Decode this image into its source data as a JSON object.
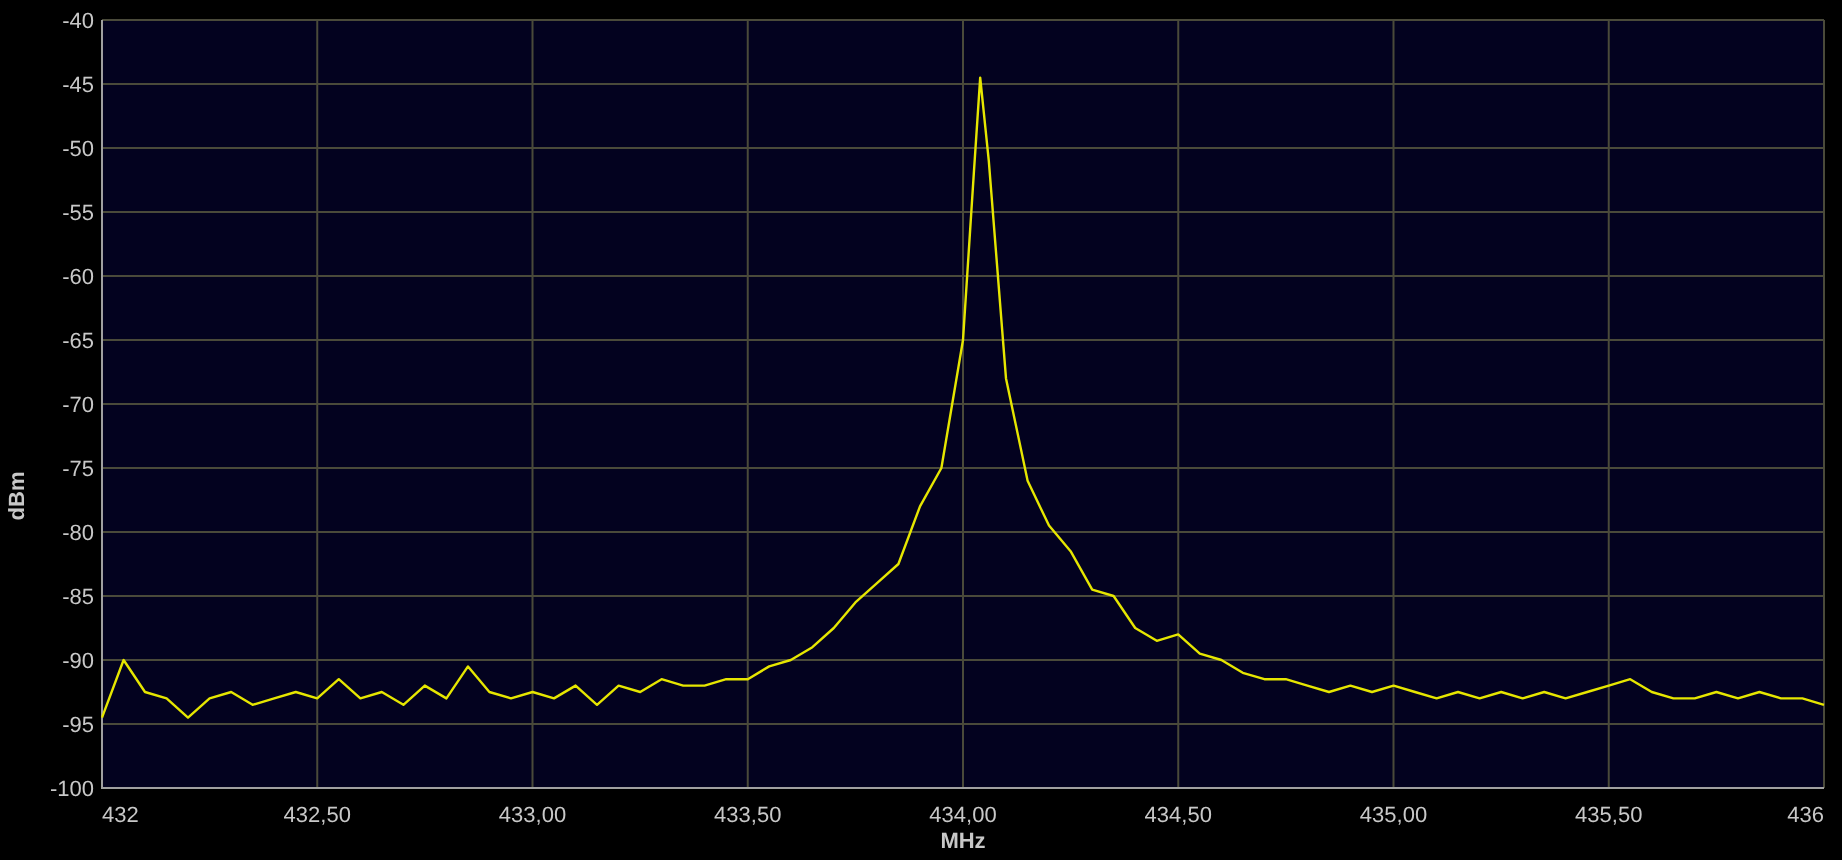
{
  "chart_data": {
    "type": "line",
    "grid": true,
    "xlabel": "MHz",
    "ylabel": "dBm",
    "xlim": [
      432,
      436
    ],
    "ylim": [
      -100,
      -40
    ],
    "xticks": [
      {
        "value": 432,
        "label": "432"
      },
      {
        "value": 432.5,
        "label": "432,50"
      },
      {
        "value": 433,
        "label": "433,00"
      },
      {
        "value": 433.5,
        "label": "433,50"
      },
      {
        "value": 434,
        "label": "434,00"
      },
      {
        "value": 434.5,
        "label": "434,50"
      },
      {
        "value": 435,
        "label": "435,00"
      },
      {
        "value": 435.5,
        "label": "435,50"
      },
      {
        "value": 436,
        "label": "436"
      }
    ],
    "yticks": [
      -40,
      -45,
      -50,
      -55,
      -60,
      -65,
      -70,
      -75,
      -80,
      -85,
      -90,
      -95,
      -100
    ],
    "x": [
      432,
      432.05,
      432.1,
      432.15,
      432.2,
      432.25,
      432.3,
      432.35,
      432.4,
      432.45,
      432.5,
      432.55,
      432.6,
      432.65,
      432.7,
      432.75,
      432.8,
      432.85,
      432.9,
      432.95,
      433,
      433.05,
      433.1,
      433.15,
      433.2,
      433.25,
      433.3,
      433.35,
      433.4,
      433.45,
      433.5,
      433.55,
      433.6,
      433.65,
      433.7,
      433.75,
      433.8,
      433.85,
      433.9,
      433.95,
      434,
      434.025,
      434.04,
      434.06,
      434.1,
      434.15,
      434.2,
      434.25,
      434.3,
      434.35,
      434.4,
      434.45,
      434.5,
      434.55,
      434.6,
      434.65,
      434.7,
      434.75,
      434.8,
      434.85,
      434.9,
      434.95,
      435,
      435.05,
      435.1,
      435.15,
      435.2,
      435.25,
      435.3,
      435.35,
      435.4,
      435.45,
      435.5,
      435.55,
      435.6,
      435.65,
      435.7,
      435.75,
      435.8,
      435.85,
      435.9,
      435.95,
      436
    ],
    "series": [
      {
        "color": "#e6e600",
        "values": [
          -94.5,
          -90,
          -92.5,
          -93,
          -94.5,
          -93,
          -92.5,
          -93.5,
          -93,
          -92.5,
          -93,
          -91.5,
          -93,
          -92.5,
          -93.5,
          -92,
          -93,
          -90.5,
          -92.5,
          -93,
          -92.5,
          -93,
          -92,
          -93.5,
          -92,
          -92.5,
          -91.5,
          -92,
          -92,
          -91.5,
          -91.5,
          -90.5,
          -90,
          -89,
          -87.5,
          -85.5,
          -84,
          -82.5,
          -78,
          -75,
          -65,
          -52,
          -44.5,
          -51,
          -68,
          -76,
          -79.5,
          -81.5,
          -84.5,
          -85,
          -87.5,
          -88.5,
          -88,
          -89.5,
          -90,
          -91,
          -91.5,
          -91.5,
          -92,
          -92.5,
          -92,
          -92.5,
          -92,
          -92.5,
          -93,
          -92.5,
          -93,
          -92.5,
          -93,
          -92.5,
          -93,
          -92.5,
          -92,
          -91.5,
          -92.5,
          -93,
          -93,
          -92.5,
          -93,
          -92.5,
          -93,
          -93,
          -93.5
        ]
      }
    ]
  }
}
